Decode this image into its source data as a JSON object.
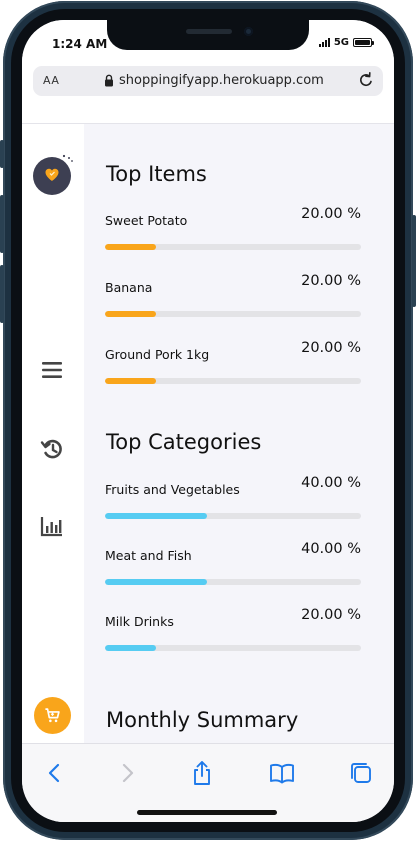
{
  "status_bar": {
    "time": "1:24 AM",
    "network": "5G"
  },
  "browser": {
    "text_size_label": "AA",
    "url": "shoppingifyapp.herokuapp.com",
    "lock_icon": "lock-icon",
    "reload_icon": "reload-icon"
  },
  "sidebar": {
    "logo_icon": "heart-logo-icon",
    "nav": [
      {
        "icon": "list-icon",
        "label": "items"
      },
      {
        "icon": "history-icon",
        "label": "history"
      },
      {
        "icon": "statistics-icon",
        "label": "statistics"
      }
    ],
    "cart_icon": "cart-icon",
    "cart_color": "#f9a51b"
  },
  "top_items": {
    "title": "Top Items",
    "bar_color": "#f9a51b",
    "items": [
      {
        "name": "Sweet Potato",
        "percent_label": "20.00 %",
        "value": 0.2
      },
      {
        "name": "Banana",
        "percent_label": "20.00 %",
        "value": 0.2
      },
      {
        "name": "Ground Pork 1kg",
        "percent_label": "20.00 %",
        "value": 0.2
      }
    ]
  },
  "top_categories": {
    "title": "Top Categories",
    "bar_color": "#56ccf2",
    "items": [
      {
        "name": "Fruits and Vegetables",
        "percent_label": "40.00 %",
        "value": 0.4
      },
      {
        "name": "Meat and Fish",
        "percent_label": "40.00 %",
        "value": 0.4
      },
      {
        "name": "Milk Drinks",
        "percent_label": "20.00 %",
        "value": 0.2
      }
    ]
  },
  "monthly_summary": {
    "title": "Monthly Summary"
  },
  "toolbar": {
    "buttons": [
      "back-icon",
      "forward-icon",
      "share-icon",
      "bookmarks-icon",
      "tabs-icon"
    ],
    "accent": "#1f7aea"
  }
}
